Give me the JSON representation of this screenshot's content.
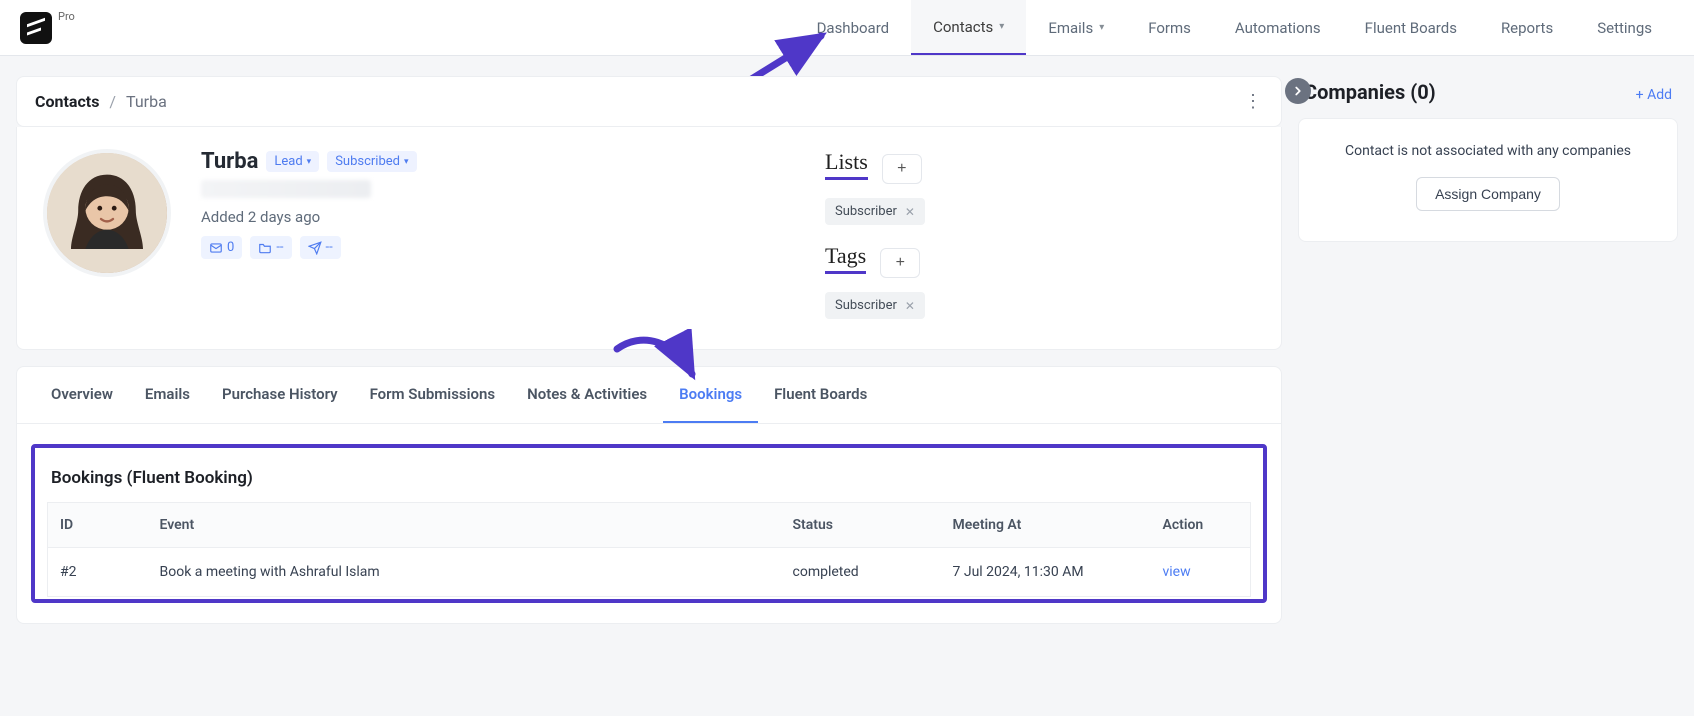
{
  "app": {
    "pro_label": "Pro"
  },
  "nav": {
    "items": [
      {
        "label": "Dashboard"
      },
      {
        "label": "Contacts",
        "active": true,
        "dropdown": true
      },
      {
        "label": "Emails",
        "dropdown": true
      },
      {
        "label": "Forms"
      },
      {
        "label": "Automations"
      },
      {
        "label": "Fluent Boards"
      },
      {
        "label": "Reports"
      },
      {
        "label": "Settings"
      }
    ]
  },
  "breadcrumb": {
    "root": "Contacts",
    "current": "Turba"
  },
  "contact": {
    "name": "Turba",
    "lead_badge": "Lead",
    "subscribed_badge": "Subscribed",
    "added_text": "Added 2 days ago",
    "stats": {
      "emails": "0",
      "folders": "--",
      "sends": "--"
    }
  },
  "lists": {
    "label": "Lists",
    "items": [
      {
        "name": "Subscriber"
      }
    ]
  },
  "tags": {
    "label": "Tags",
    "items": [
      {
        "name": "Subscriber"
      }
    ]
  },
  "tabs": [
    {
      "label": "Overview"
    },
    {
      "label": "Emails"
    },
    {
      "label": "Purchase History"
    },
    {
      "label": "Form Submissions"
    },
    {
      "label": "Notes & Activities"
    },
    {
      "label": "Bookings",
      "active": true
    },
    {
      "label": "Fluent Boards"
    }
  ],
  "bookings": {
    "title": "Bookings (Fluent Booking)",
    "columns": {
      "id": "ID",
      "event": "Event",
      "status": "Status",
      "meeting": "Meeting At",
      "action": "Action"
    },
    "rows": [
      {
        "id": "#2",
        "event": "Book a meeting with Ashraful Islam",
        "status": "completed",
        "meeting": "7 Jul 2024, 11:30 AM",
        "action": "view"
      }
    ]
  },
  "companies": {
    "title": "Companies (0)",
    "add_label": "+ Add",
    "empty_text": "Contact is not associated with any companies",
    "assign_button": "Assign Company"
  }
}
